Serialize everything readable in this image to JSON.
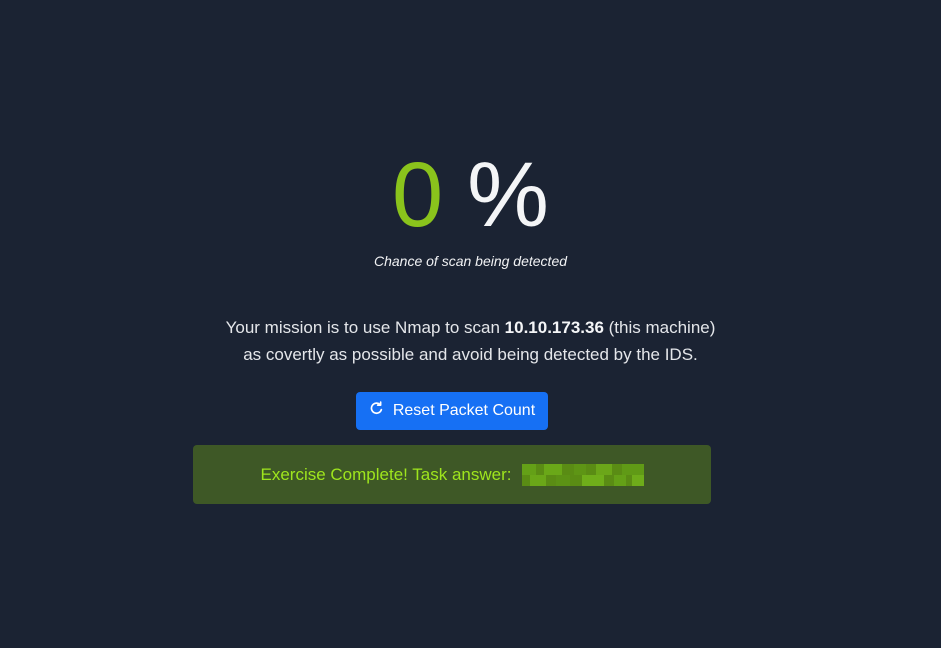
{
  "detection": {
    "value": "0",
    "unit": "%",
    "caption": "Chance of scan being detected"
  },
  "mission": {
    "line1_prefix": "Your mission is to use Nmap to scan ",
    "target_ip": "10.10.173.36",
    "line1_suffix": " (this machine)",
    "line2": "as covertly as possible and avoid being detected by the IDS."
  },
  "reset_button": {
    "label": "Reset Packet Count",
    "icon": "refresh-icon"
  },
  "result": {
    "label": "Exercise Complete! Task answer:",
    "answer_redacted": true
  },
  "colors": {
    "background": "#1b2333",
    "accent_green": "#8ac31c",
    "button_blue": "#1670f4",
    "alert_bg": "#3e5826",
    "alert_text": "#9ee51d"
  }
}
